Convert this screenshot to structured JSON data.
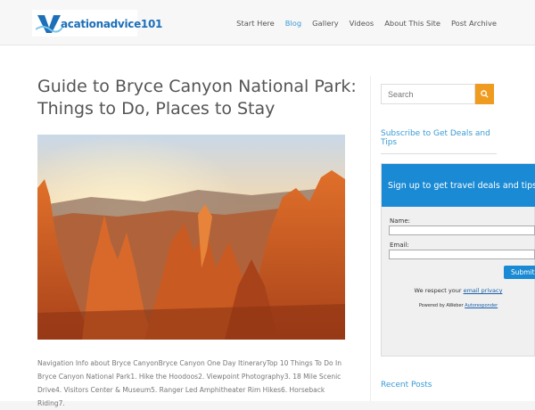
{
  "header": {
    "logo_text": "acationadvice101",
    "logo_letter": "V",
    "nav": [
      {
        "label": "Start Here",
        "active": false
      },
      {
        "label": "Blog",
        "active": true
      },
      {
        "label": "Gallery",
        "active": false
      },
      {
        "label": "Videos",
        "active": false
      },
      {
        "label": "About This Site",
        "active": false
      },
      {
        "label": "Post Archive",
        "active": false
      }
    ]
  },
  "article": {
    "title": "Guide to Bryce Canyon National Park: Things to Do, Places to Stay",
    "body": "Navigation Info about Bryce CanyonBryce Canyon One Day ItineraryTop 10 Things To Do In Bryce Canyon National Park1. Hike the Hoodoos2. Viewpoint Photography3. 18 Mile Scenic Drive4. Visitors Center & Museum5. Ranger Led Amphitheater Rim Hikes6. Horseback Riding7."
  },
  "sidebar": {
    "search_placeholder": "Search",
    "subscribe_title": "Subscribe to Get Deals and Tips",
    "signup_header": "Sign up to get travel deals and tips",
    "name_label": "Name:",
    "email_label": "Email:",
    "submit_label": "Submit",
    "privacy_text": "We respect your ",
    "privacy_link": "email privacy",
    "powered_text": "Powered by AWeber ",
    "powered_link": "Autoresponder",
    "recent_posts": "Recent Posts"
  },
  "colors": {
    "accent": "#3a9bd5",
    "search_button": "#ef9b1f",
    "signup_header": "#1a8ad4"
  }
}
